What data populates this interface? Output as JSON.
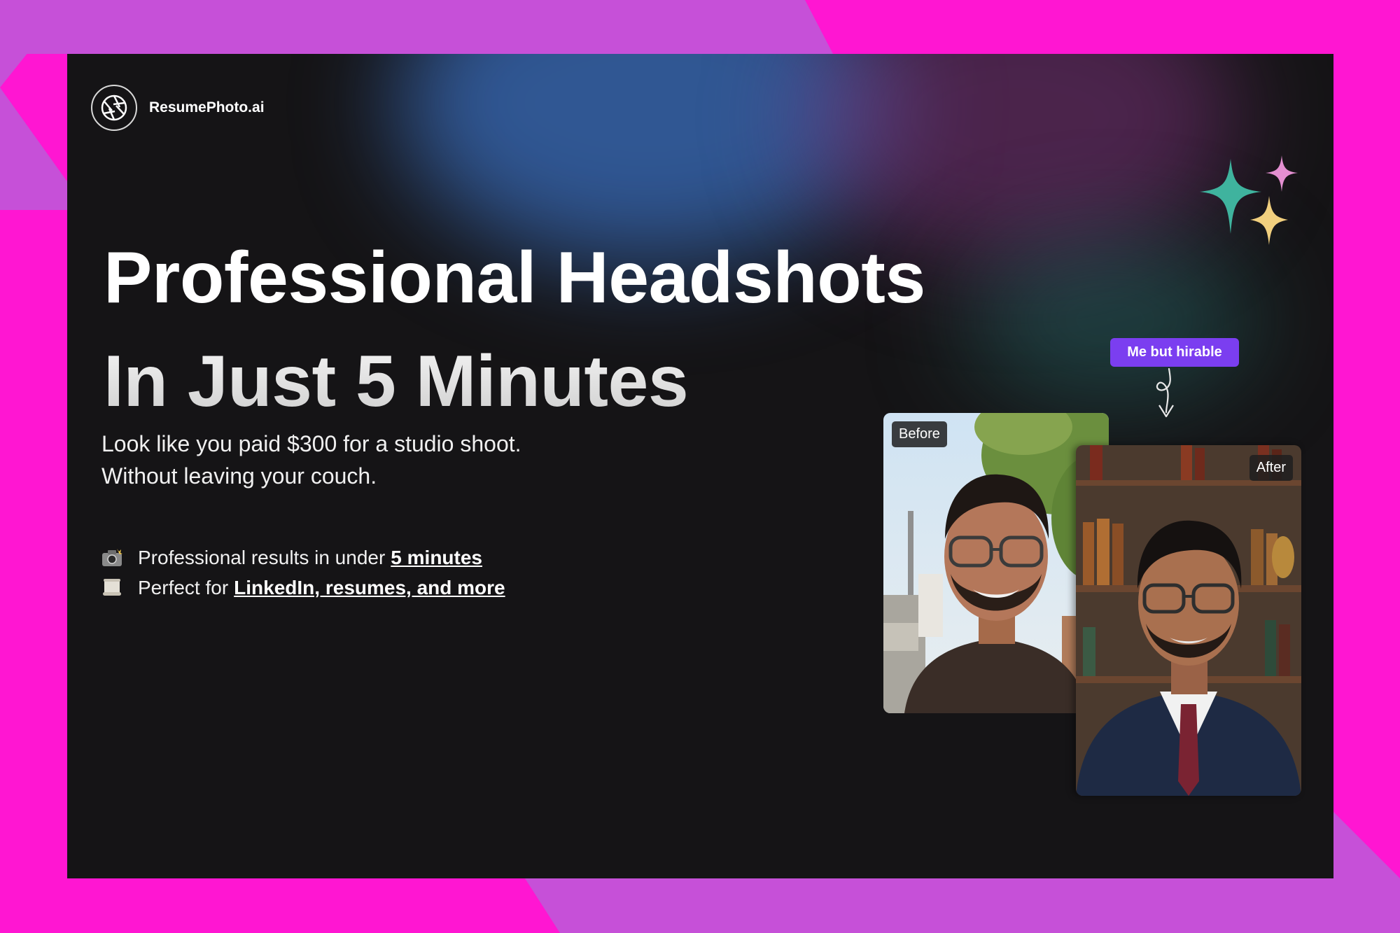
{
  "brand": {
    "name": "ResumePhoto.ai",
    "icon": "aperture-icon"
  },
  "hero": {
    "headline_line1": "Professional Headshots",
    "headline_line2": "In Just 5 Minutes",
    "subtitle_line1": "Look like you paid $300 for a studio shoot.",
    "subtitle_line2": "Without leaving your couch."
  },
  "features": [
    {
      "icon": "camera-flash-icon",
      "text": "Professional results in under",
      "link": "5 minutes"
    },
    {
      "icon": "scroll-icon",
      "text": "Perfect for",
      "link": "LinkedIn, resumes, and more"
    }
  ],
  "tag": {
    "label": "Me but hirable",
    "color": "#7b3ef0"
  },
  "photos": {
    "before_label": "Before",
    "after_label": "After"
  },
  "colors": {
    "background_magenta": "#ff16d2",
    "background_violet": "#c650d8",
    "panel": "#151416",
    "sparkle_teal": "#3fb39e",
    "sparkle_pink": "#e48fd1",
    "sparkle_yellow": "#f1cf7e"
  }
}
